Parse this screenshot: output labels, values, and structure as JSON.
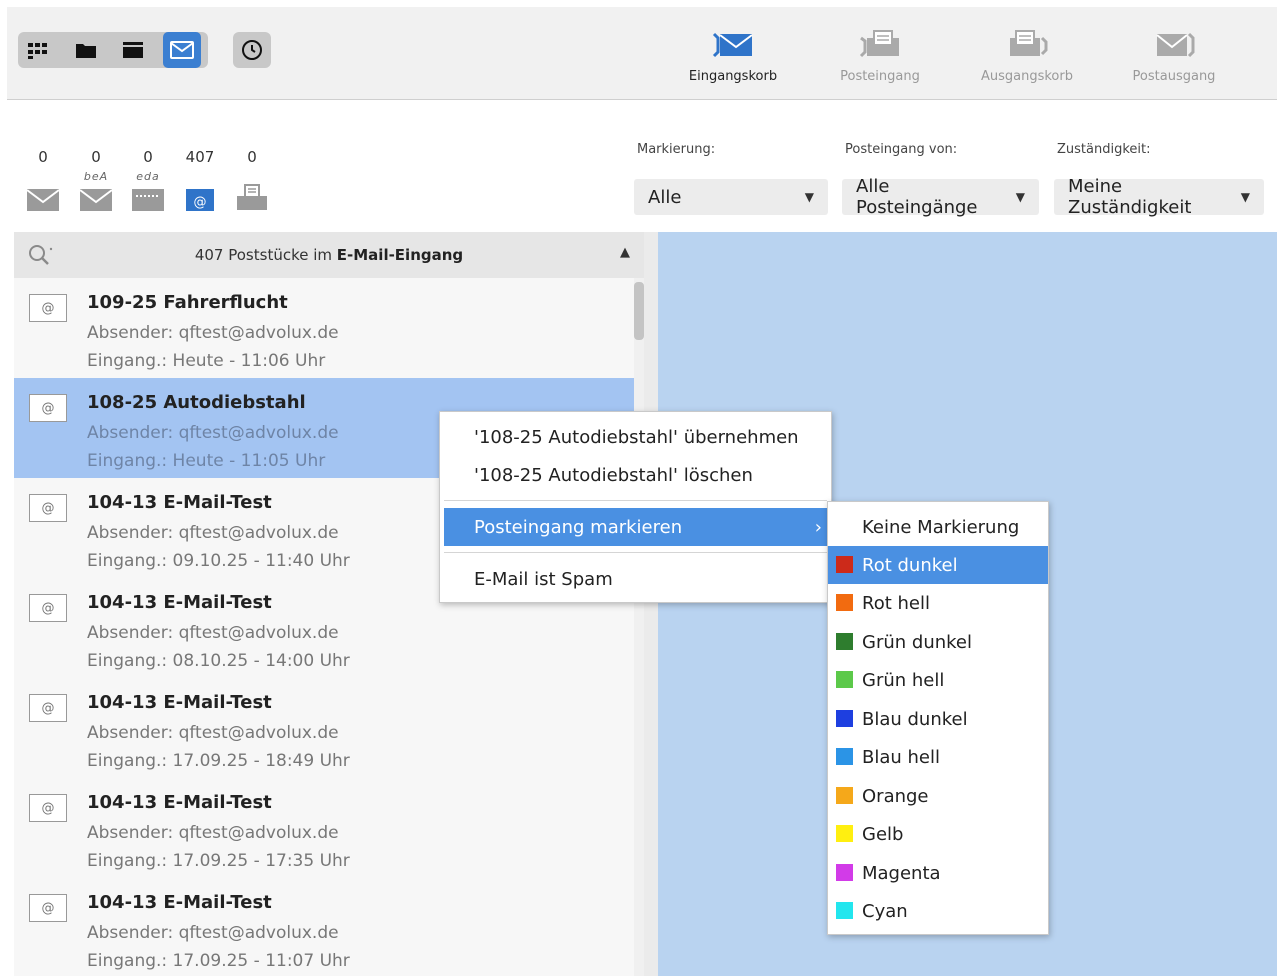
{
  "toolbar": {
    "view_buttons": [
      "grid-view",
      "folder-view",
      "list-view",
      "mail-view"
    ],
    "trays": [
      {
        "label": "Eingangskorb",
        "active": true
      },
      {
        "label": "Posteingang",
        "active": false
      },
      {
        "label": "Ausgangskorb",
        "active": false
      },
      {
        "label": "Postausgang",
        "active": false
      }
    ]
  },
  "counters": [
    {
      "count": "0",
      "sub": "",
      "icon": "envelope-icon"
    },
    {
      "count": "0",
      "sub": "beA",
      "icon": "bea-envelope-icon"
    },
    {
      "count": "0",
      "sub": "eda",
      "icon": "eda-icon"
    },
    {
      "count": "407",
      "sub": "",
      "icon": "email-at-icon"
    },
    {
      "count": "0",
      "sub": "",
      "icon": "fax-icon"
    }
  ],
  "filters": {
    "markierung": {
      "label": "Markierung:",
      "value": "Alle"
    },
    "posteingang_von": {
      "label": "Posteingang von:",
      "value": "Alle Posteingänge"
    },
    "zustaendigkeit": {
      "label": "Zuständigkeit:",
      "value": "Meine Zuständigkeit"
    }
  },
  "list": {
    "header_prefix": "407 Poststücke im ",
    "header_bold": "E-Mail-Eingang",
    "items": [
      {
        "title": "109-25 Fahrerflucht",
        "sender": "Absender: qftest@advolux.de",
        "date": "Eingang.: Heute - 11:06 Uhr",
        "selected": false
      },
      {
        "title": "108-25 Autodiebstahl",
        "sender": "Absender: qftest@advolux.de",
        "date": "Eingang.: Heute - 11:05 Uhr",
        "selected": true
      },
      {
        "title": "104-13 E-Mail-Test",
        "sender": "Absender: qftest@advolux.de",
        "date": "Eingang.: 09.10.25 - 11:40 Uhr",
        "selected": false
      },
      {
        "title": "104-13 E-Mail-Test",
        "sender": "Absender: qftest@advolux.de",
        "date": "Eingang.: 08.10.25 - 14:00 Uhr",
        "selected": false
      },
      {
        "title": "104-13 E-Mail-Test",
        "sender": "Absender: qftest@advolux.de",
        "date": "Eingang.: 17.09.25 - 18:49 Uhr",
        "selected": false
      },
      {
        "title": "104-13 E-Mail-Test",
        "sender": "Absender: qftest@advolux.de",
        "date": "Eingang.: 17.09.25 - 17:35 Uhr",
        "selected": false
      },
      {
        "title": "104-13 E-Mail-Test",
        "sender": "Absender: qftest@advolux.de",
        "date": "Eingang.: 17.09.25 - 11:07 Uhr",
        "selected": false
      }
    ]
  },
  "context_menu": {
    "uebernehmen": "'108-25 Autodiebstahl' übernehmen",
    "loeschen": "'108-25 Autodiebstahl' löschen",
    "markieren": "Posteingang markieren",
    "spam": "E-Mail ist Spam"
  },
  "marker_submenu": {
    "none": "Keine Markierung",
    "colors": [
      {
        "label": "Rot dunkel",
        "color": "#cc2a1a",
        "highlighted": true
      },
      {
        "label": "Rot hell",
        "color": "#f26b10",
        "highlighted": false
      },
      {
        "label": "Grün dunkel",
        "color": "#2e7d2e",
        "highlighted": false
      },
      {
        "label": "Grün hell",
        "color": "#5cc94a",
        "highlighted": false
      },
      {
        "label": "Blau dunkel",
        "color": "#1e3fe0",
        "highlighted": false
      },
      {
        "label": "Blau hell",
        "color": "#2b94e6",
        "highlighted": false
      },
      {
        "label": "Orange",
        "color": "#f5a81a",
        "highlighted": false
      },
      {
        "label": "Gelb",
        "color": "#ffef10",
        "highlighted": false
      },
      {
        "label": "Magenta",
        "color": "#d23be8",
        "highlighted": false
      },
      {
        "label": "Cyan",
        "color": "#22e6ee",
        "highlighted": false
      }
    ]
  },
  "colors": {
    "accent": "#3b7fd1",
    "selection": "#a3c4f2",
    "detail_bg": "#b9d3f0",
    "menu_highlight": "#4a90e2"
  }
}
